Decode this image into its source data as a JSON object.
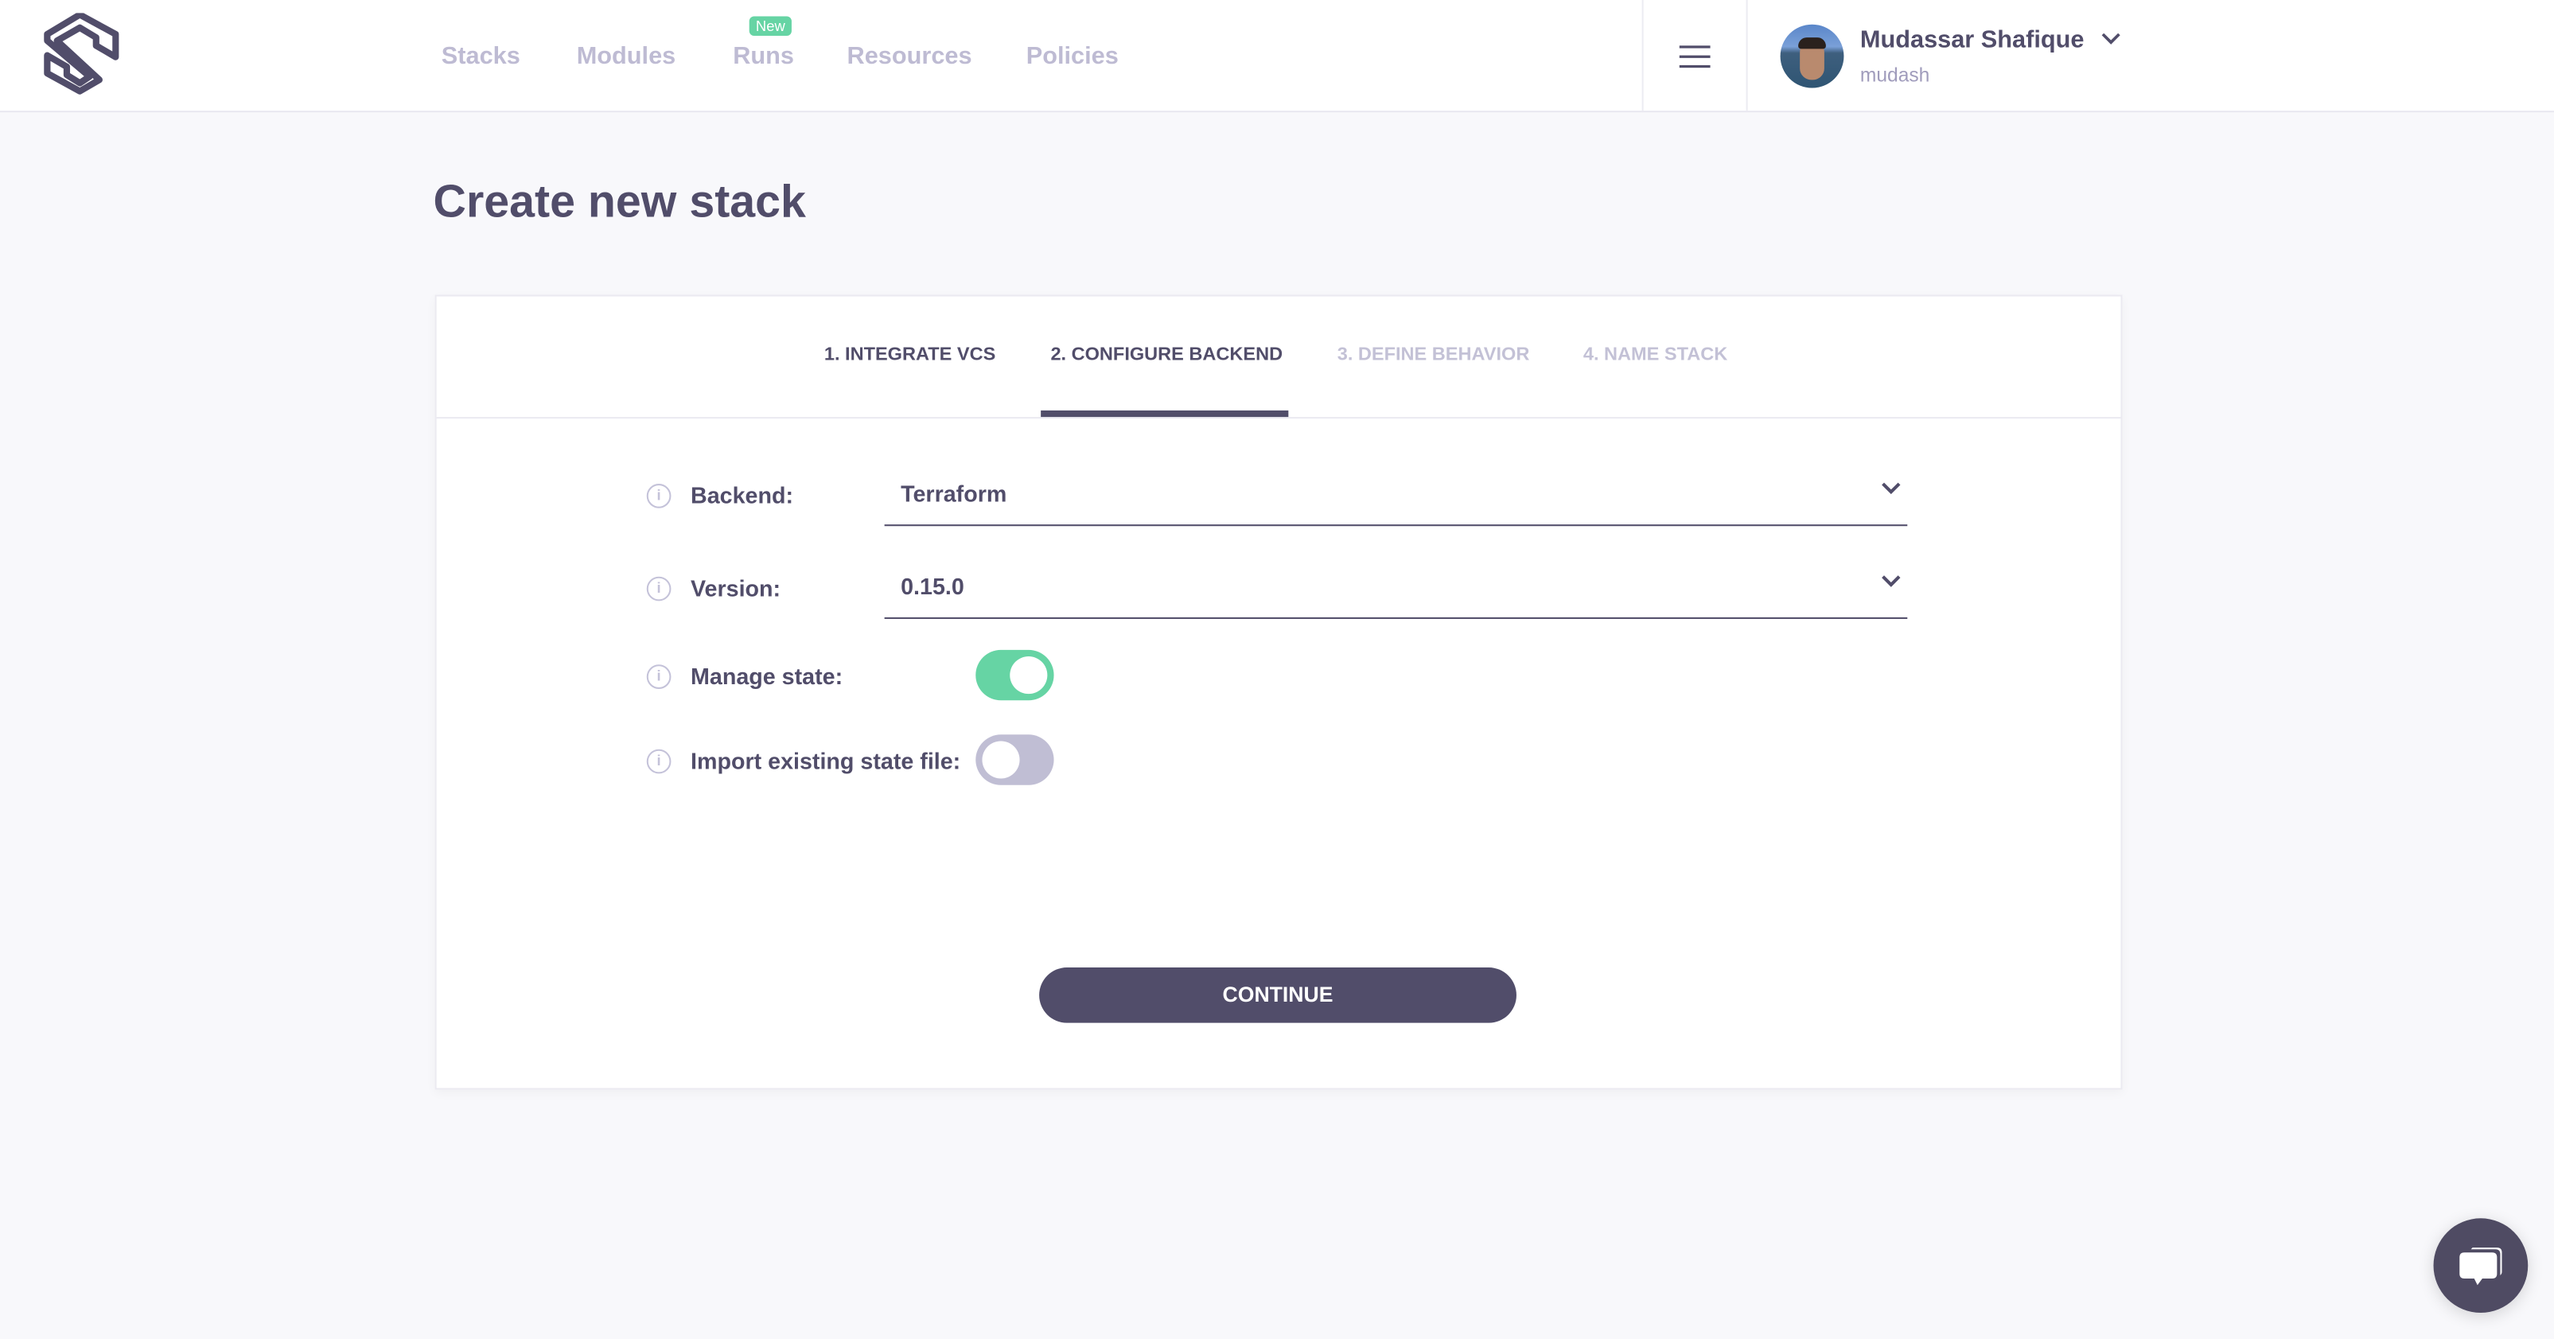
{
  "nav": {
    "items": [
      {
        "label": "Stacks"
      },
      {
        "label": "Modules"
      },
      {
        "label": "Runs",
        "badge": "New"
      },
      {
        "label": "Resources"
      },
      {
        "label": "Policies"
      }
    ]
  },
  "user": {
    "name": "Mudassar Shafique",
    "username": "mudash"
  },
  "page": {
    "title": "Create new stack"
  },
  "steps": [
    {
      "label": "1. INTEGRATE VCS",
      "state": "done"
    },
    {
      "label": "2. CONFIGURE BACKEND",
      "state": "active"
    },
    {
      "label": "3. DEFINE BEHAVIOR",
      "state": "pending"
    },
    {
      "label": "4. NAME STACK",
      "state": "pending"
    }
  ],
  "form": {
    "backend": {
      "label": "Backend:",
      "value": "Terraform"
    },
    "version": {
      "label": "Version:",
      "value": "0.15.0"
    },
    "manage_state": {
      "label": "Manage state:",
      "on": true
    },
    "import_state": {
      "label": "Import existing state file:",
      "on": false
    },
    "continue_label": "CONTINUE"
  },
  "colors": {
    "primary": "#514d6a",
    "accent_green": "#66d4a4",
    "toggle_off": "#c0bed4"
  },
  "icons": [
    "spacelift-logo",
    "hamburger-menu-icon",
    "chevron-down-icon",
    "info-icon",
    "chat-icon"
  ]
}
